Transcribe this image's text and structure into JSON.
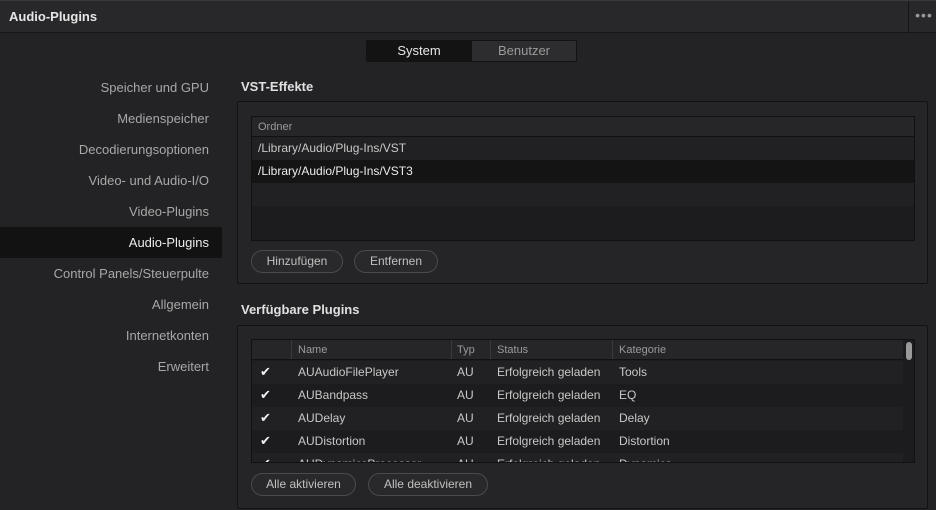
{
  "window": {
    "title": "Audio-Plugins",
    "more_label": "•••"
  },
  "tabs": [
    {
      "label": "System",
      "active": true
    },
    {
      "label": "Benutzer",
      "active": false
    }
  ],
  "sidebar": {
    "items": [
      {
        "label": "Speicher und GPU"
      },
      {
        "label": "Medienspeicher"
      },
      {
        "label": "Decodierungsoptionen"
      },
      {
        "label": "Video- und Audio-I/O"
      },
      {
        "label": "Video-Plugins"
      },
      {
        "label": "Audio-Plugins",
        "active": true
      },
      {
        "label": "Control Panels/Steuerpulte"
      },
      {
        "label": "Allgemein"
      },
      {
        "label": "Internetkonten"
      },
      {
        "label": "Erweitert"
      }
    ]
  },
  "vst": {
    "title": "VST-Effekte",
    "column_header": "Ordner",
    "folders": [
      "/Library/Audio/Plug-Ins/VST",
      "/Library/Audio/Plug-Ins/VST3"
    ],
    "add_label": "Hinzufügen",
    "remove_label": "Entfernen"
  },
  "plugins": {
    "title": "Verfügbare Plugins",
    "columns": {
      "name": "Name",
      "type": "Typ",
      "status": "Status",
      "category": "Kategorie"
    },
    "rows": [
      {
        "checked": true,
        "name": "AUAudioFilePlayer",
        "type": "AU",
        "status": "Erfolgreich geladen",
        "category": "Tools"
      },
      {
        "checked": true,
        "name": "AUBandpass",
        "type": "AU",
        "status": "Erfolgreich geladen",
        "category": "EQ"
      },
      {
        "checked": true,
        "name": "AUDelay",
        "type": "AU",
        "status": "Erfolgreich geladen",
        "category": "Delay"
      },
      {
        "checked": true,
        "name": "AUDistortion",
        "type": "AU",
        "status": "Erfolgreich geladen",
        "category": "Distortion"
      },
      {
        "checked": true,
        "name": "AUDynamicsProcessor",
        "type": "AU",
        "status": "Erfolgreich geladen",
        "category": "Dynamics"
      }
    ],
    "enable_all_label": "Alle aktivieren",
    "disable_all_label": "Alle deaktivieren"
  }
}
